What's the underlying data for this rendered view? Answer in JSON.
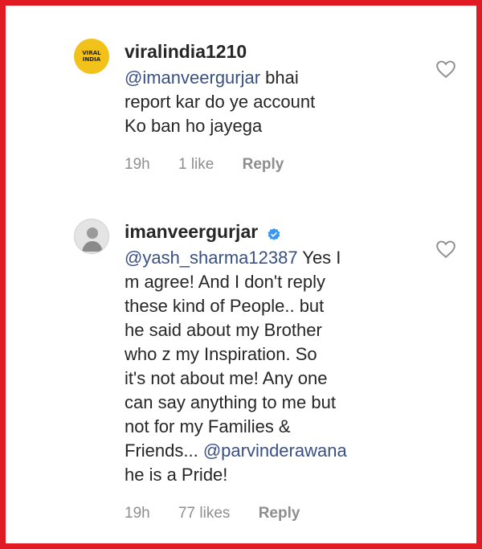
{
  "comments": [
    {
      "username": "viralindia1210",
      "avatar_text": "VIRAL INDIA",
      "mention": "@imanveergurjar",
      "text_lines": [
        " bhai",
        "report kar do ye account",
        "Ko ban ho jayega"
      ],
      "time": "19h",
      "likes": "1 like",
      "reply": "Reply"
    },
    {
      "username": "imanveergurjar",
      "verified": true,
      "mention": "@yash_sharma12387",
      "line1_rest": " Yes I",
      "lines": [
        "m agree! And I don't reply",
        "these kind of People.. but",
        "he said about my Brother",
        "who z my Inspiration. So",
        "it's not about me! Any one",
        "can say anything to me but",
        "not for my Families &"
      ],
      "line_pre_mention": "Friends... ",
      "mention2": "@parvinderawana",
      "last_line": "he is a Pride!",
      "time": "19h",
      "likes": "77 likes",
      "reply": "Reply"
    }
  ],
  "colors": {
    "border": "#e01b24",
    "mention": "#385185",
    "meta": "#8e8e8e",
    "verified": "#3897f0"
  }
}
